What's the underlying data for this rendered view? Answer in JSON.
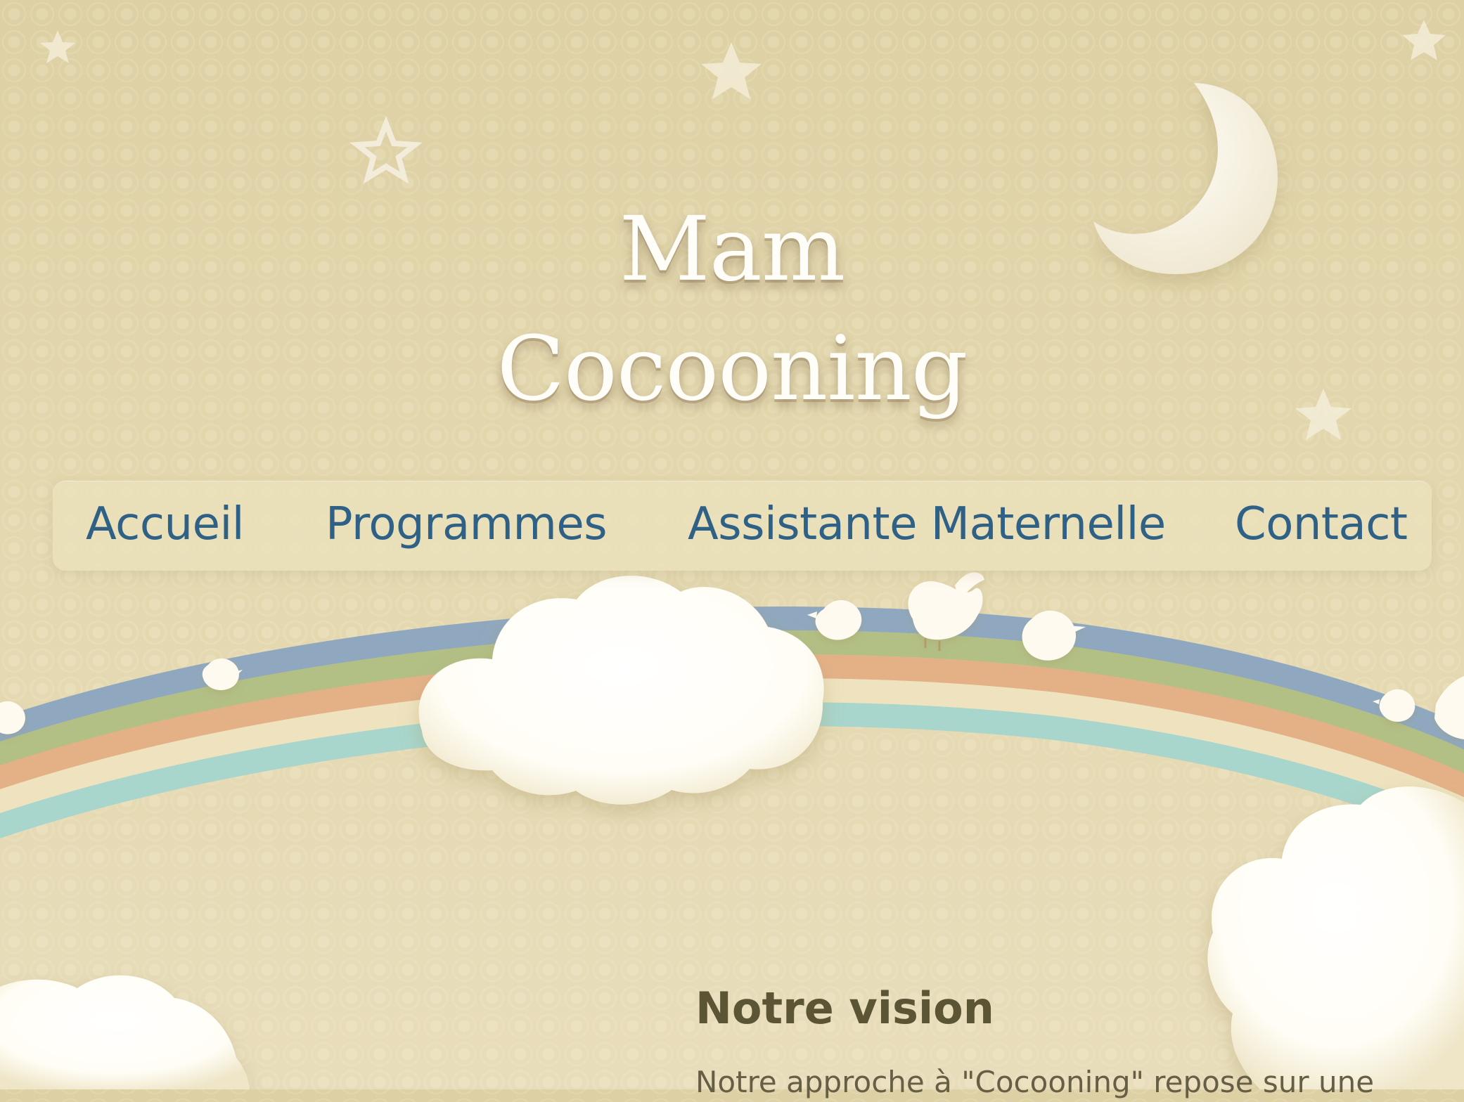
{
  "site": {
    "title_lines": [
      "Mam",
      "Cocooning"
    ]
  },
  "nav": {
    "items": [
      {
        "label": "Accueil"
      },
      {
        "label": "Programmes"
      },
      {
        "label": "Assistante Maternelle"
      },
      {
        "label": "Contact"
      }
    ]
  },
  "content": {
    "heading": "Notre vision",
    "paragraph": "Notre approche à \"Cocooning\" repose sur une"
  },
  "colors": {
    "background": "#e4d9b3",
    "nav_text": "#2f6186",
    "heading_text": "#5b5535",
    "body_text": "#665f45",
    "title_text": "#fffdf8"
  },
  "icons": [
    "star-icon",
    "moon-icon",
    "cloud-icon",
    "bird-icon",
    "rainbow-icon"
  ]
}
